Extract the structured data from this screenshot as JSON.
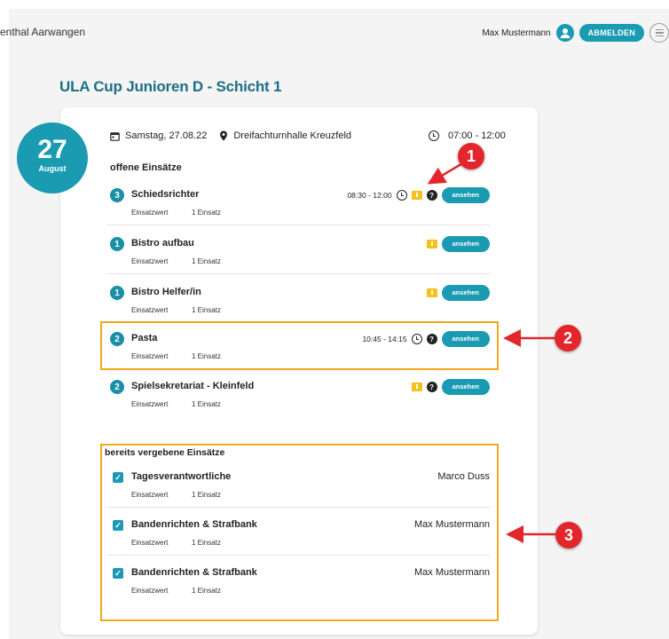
{
  "header": {
    "site_title_fragment": "enthal Aarwangen",
    "user_name": "Max Mustermann",
    "logout_label": "ABMELDEN"
  },
  "page_title": "ULA Cup Junioren D - Schicht 1",
  "date_badge": {
    "day": "27",
    "month": "August"
  },
  "event": {
    "date": "Samstag, 27.08.22",
    "location": "Dreifachturnhalle Kreuzfeld",
    "time": "07:00 - 12:00"
  },
  "open_section_label": "offene Einsätze",
  "assigned_section_label": "bereits vergebene Einsätze",
  "value_label": "Einsatzwert",
  "view_label": "ansehen",
  "open_jobs": [
    {
      "count": "3",
      "name": "Schiedsrichter",
      "value": "1 Einsatz",
      "time": "08:30 - 12:00"
    },
    {
      "count": "1",
      "name": "Bistro aufbau",
      "value": "1 Einsatz"
    },
    {
      "count": "1",
      "name": "Bistro Helfer/in",
      "value": "1 Einsatz"
    },
    {
      "count": "2",
      "name": "Pasta",
      "value": "1 Einsatz",
      "time": "10:45 - 14:15"
    },
    {
      "count": "2",
      "name": "Spielsekretariat - Kleinfeld",
      "value": "1 Einsatz"
    }
  ],
  "assigned_jobs": [
    {
      "name": "Tagesverantwortliche",
      "value": "1 Einsatz",
      "person": "Marco Duss"
    },
    {
      "name": "Bandenrichten & Strafbank",
      "value": "1 Einsatz",
      "person": "Max Mustermann"
    },
    {
      "name": "Bandenrichten & Strafbank",
      "value": "1 Einsatz",
      "person": "Max Mustermann"
    }
  ],
  "annotations": [
    "1",
    "2",
    "3"
  ],
  "colors": {
    "accent": "#1a9bb2",
    "title": "#1d6f83",
    "highlight": "#f0a81c",
    "marker": "#e3262b",
    "note": "#f5c21b"
  }
}
